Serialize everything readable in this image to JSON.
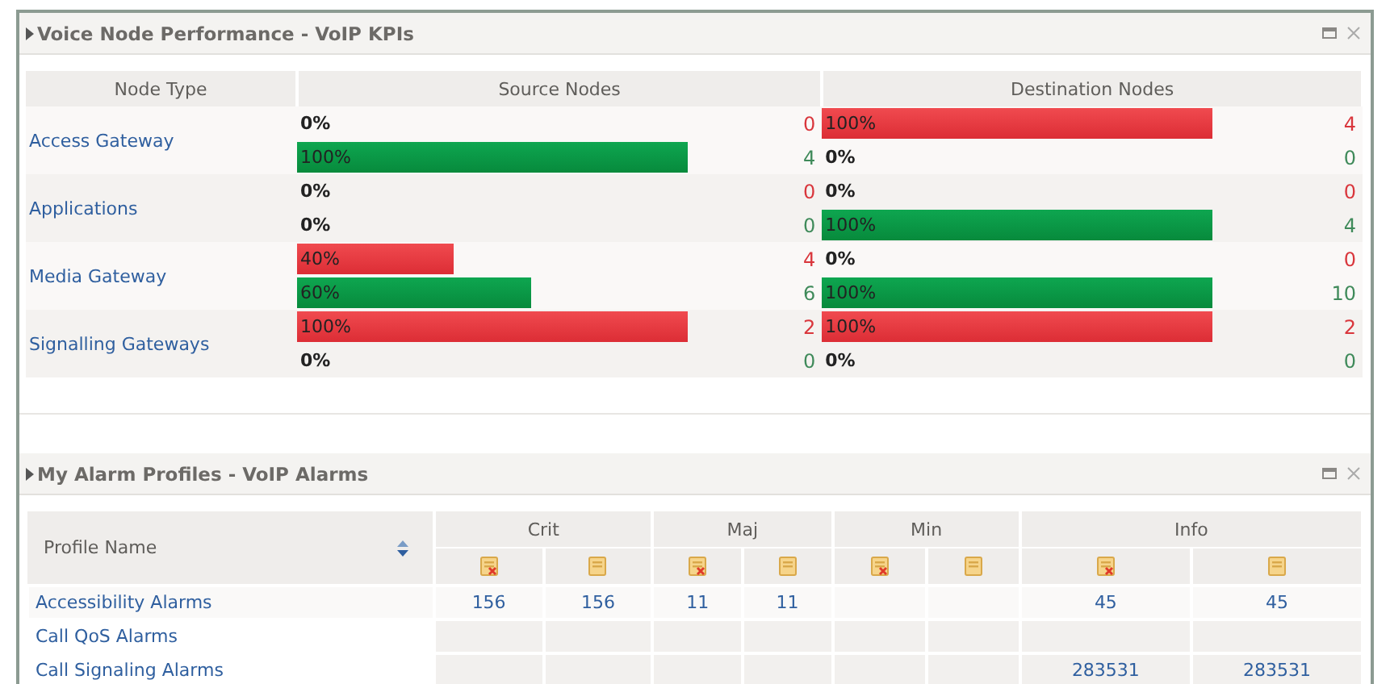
{
  "kpi_panel": {
    "title": "Voice Node Performance - VoIP KPIs",
    "table": {
      "columns": [
        "Node Type",
        "Source Nodes",
        "Destination Nodes"
      ],
      "rows": [
        {
          "node_type": "Access Gateway",
          "source": [
            {
              "kind": "failed",
              "percent": "0%",
              "count": "0"
            },
            {
              "kind": "passed",
              "percent": "100%",
              "count": "4"
            }
          ],
          "destination": [
            {
              "kind": "failed",
              "percent": "100%",
              "count": "4"
            },
            {
              "kind": "passed",
              "percent": "0%",
              "count": "0"
            }
          ]
        },
        {
          "node_type": "Applications",
          "source": [
            {
              "kind": "failed",
              "percent": "0%",
              "count": "0"
            },
            {
              "kind": "passed",
              "percent": "0%",
              "count": "0"
            }
          ],
          "destination": [
            {
              "kind": "failed",
              "percent": "0%",
              "count": "0"
            },
            {
              "kind": "passed",
              "percent": "100%",
              "count": "4"
            }
          ]
        },
        {
          "node_type": "Media Gateway",
          "source": [
            {
              "kind": "failed",
              "percent": "40%",
              "count": "4"
            },
            {
              "kind": "passed",
              "percent": "60%",
              "count": "6"
            }
          ],
          "destination": [
            {
              "kind": "failed",
              "percent": "0%",
              "count": "0"
            },
            {
              "kind": "passed",
              "percent": "100%",
              "count": "10"
            }
          ]
        },
        {
          "node_type": "Signalling Gateways",
          "source": [
            {
              "kind": "failed",
              "percent": "100%",
              "count": "2"
            },
            {
              "kind": "passed",
              "percent": "0%",
              "count": "0"
            }
          ],
          "destination": [
            {
              "kind": "failed",
              "percent": "100%",
              "count": "2"
            },
            {
              "kind": "passed",
              "percent": "0%",
              "count": "0"
            }
          ]
        }
      ]
    }
  },
  "alarm_panel": {
    "title": "My Alarm Profiles - VoIP Alarms",
    "table": {
      "name_column": "Profile Name",
      "severity_groups": [
        "Crit",
        "Maj",
        "Min",
        "Info"
      ],
      "rows": [
        {
          "profile": "Accessibility Alarms",
          "cells": [
            {
              "kind": "count",
              "value": "156"
            },
            {
              "kind": "count",
              "value": "156"
            },
            {
              "kind": "count",
              "value": "11"
            },
            {
              "kind": "count",
              "value": "11"
            },
            {
              "kind": "empty"
            },
            {
              "kind": "empty"
            },
            {
              "kind": "count",
              "value": "45"
            },
            {
              "kind": "count",
              "value": "45"
            }
          ]
        },
        {
          "profile": "Call QoS Alarms",
          "cells": [
            {
              "kind": "empty"
            },
            {
              "kind": "empty"
            },
            {
              "kind": "empty"
            },
            {
              "kind": "empty"
            },
            {
              "kind": "empty"
            },
            {
              "kind": "empty"
            },
            {
              "kind": "empty"
            },
            {
              "kind": "empty"
            }
          ]
        },
        {
          "profile": "Call Signaling Alarms",
          "cells": [
            {
              "kind": "empty"
            },
            {
              "kind": "empty"
            },
            {
              "kind": "empty"
            },
            {
              "kind": "empty"
            },
            {
              "kind": "empty"
            },
            {
              "kind": "empty"
            },
            {
              "kind": "count",
              "value": "283531"
            },
            {
              "kind": "count",
              "value": "283531"
            }
          ]
        }
      ]
    }
  }
}
